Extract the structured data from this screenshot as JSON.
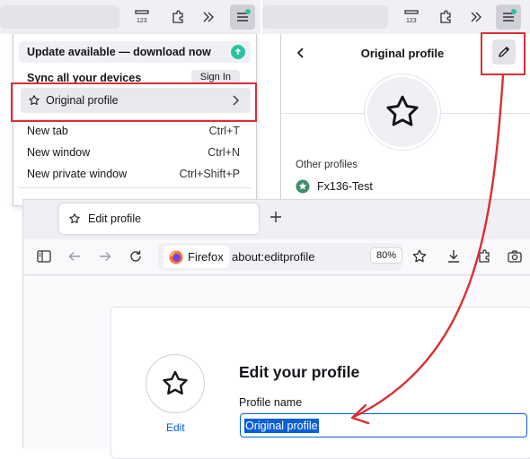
{
  "app_menu": {
    "update_label": "Update available — download now",
    "sync_label": "Sync all your devices",
    "sign_in_label": "Sign In",
    "profile_label": "Original profile",
    "items": [
      {
        "label": "New tab",
        "shortcut": "Ctrl+T"
      },
      {
        "label": "New window",
        "shortcut": "Ctrl+N"
      },
      {
        "label": "New private window",
        "shortcut": "Ctrl+Shift+P"
      }
    ]
  },
  "profile_panel": {
    "title": "Original profile",
    "other_profiles_heading": "Other profiles",
    "other_profiles": [
      {
        "name": "Fx136-Test"
      }
    ]
  },
  "browser": {
    "tab_title": "Edit profile",
    "identity_label": "Firefox",
    "url": "about:editprofile",
    "zoom": "80%"
  },
  "edit_profile": {
    "avatar_edit_link": "Edit",
    "heading": "Edit your profile",
    "profile_name_label": "Profile name",
    "profile_name_value": "Original profile"
  },
  "colors": {
    "highlight": "#dc2d35",
    "accent": "#0061e0",
    "update_badge": "#2ac3a2"
  }
}
